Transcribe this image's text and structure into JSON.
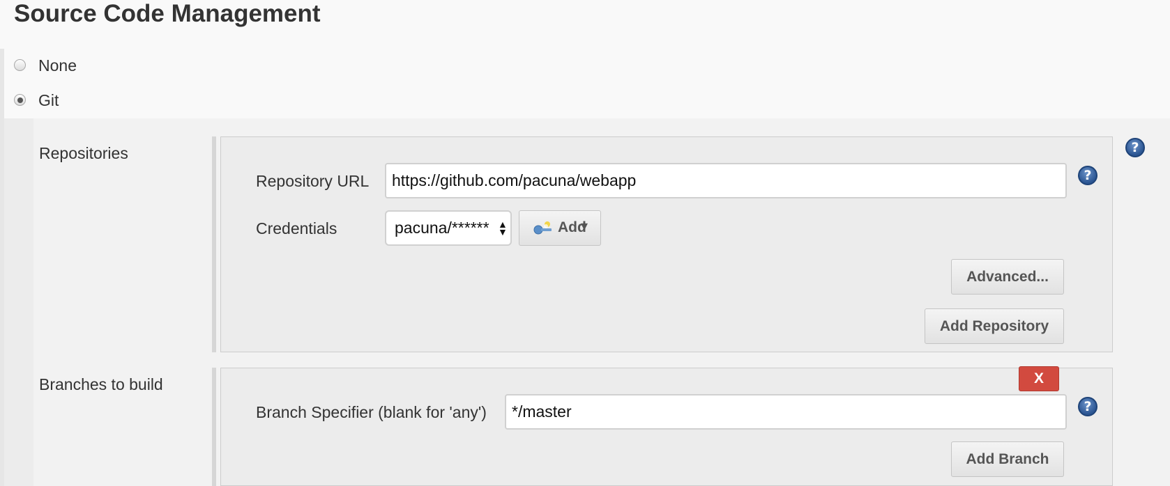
{
  "section": {
    "title": "Source Code Management"
  },
  "scm_options": [
    {
      "label": "None",
      "selected": false
    },
    {
      "label": "Git",
      "selected": true
    }
  ],
  "repositories": {
    "label": "Repositories",
    "repository_url": {
      "label": "Repository URL",
      "value": "https://github.com/pacuna/webapp"
    },
    "credentials": {
      "label": "Credentials",
      "selected_value": "pacuna/******",
      "add_button_label": "Add"
    },
    "advanced_button_label": "Advanced...",
    "add_repository_button_label": "Add Repository"
  },
  "branches": {
    "label": "Branches to build",
    "delete_button_label": "X",
    "branch_specifier": {
      "label": "Branch Specifier (blank for 'any')",
      "value": "*/master"
    },
    "add_branch_button_label": "Add Branch"
  },
  "help_icon_glyph": "?",
  "colors": {
    "delete_red": "#d24a3f",
    "help_blue": "#2b5592"
  },
  "icons": [
    "help-icon",
    "key-icon",
    "select-arrows-icon"
  ]
}
